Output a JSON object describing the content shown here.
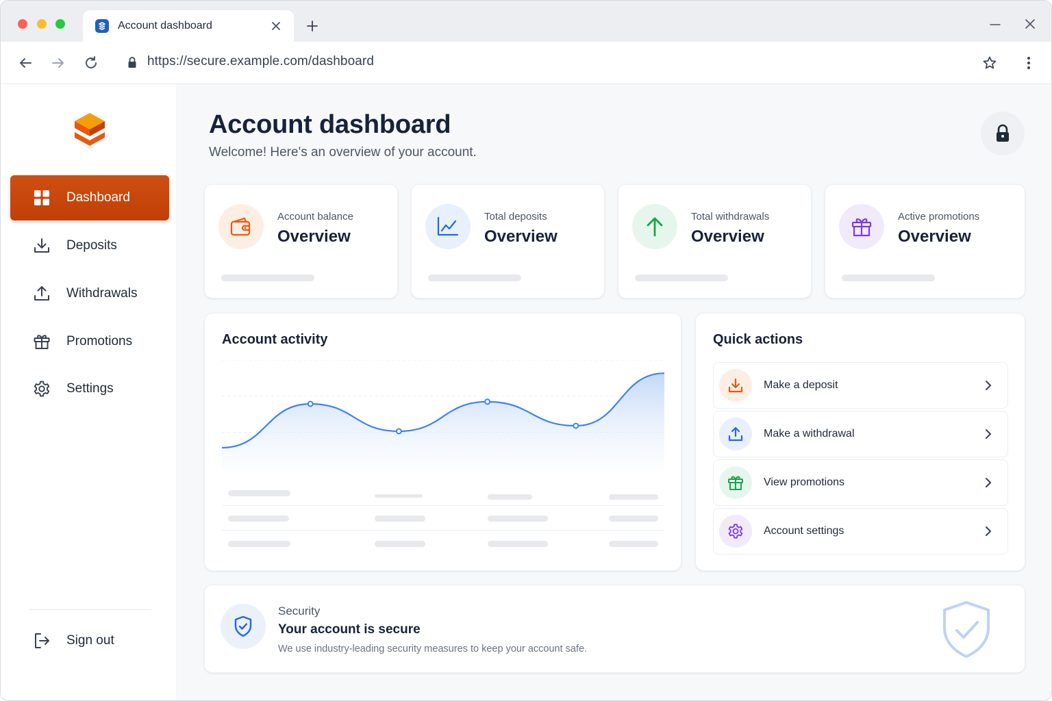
{
  "browser": {
    "tab_title": "Account dashboard",
    "url": "https://secure.example.com/dashboard"
  },
  "sidebar": {
    "items": [
      {
        "label": "Dashboard",
        "icon": "grid-icon",
        "active": true
      },
      {
        "label": "Deposits",
        "icon": "download-icon",
        "active": false
      },
      {
        "label": "Withdrawals",
        "icon": "upload-icon",
        "active": false
      },
      {
        "label": "Promotions",
        "icon": "gift-icon",
        "active": false
      },
      {
        "label": "Settings",
        "icon": "gear-icon",
        "active": false
      }
    ],
    "sign_out": "Sign out"
  },
  "header": {
    "title": "Account dashboard",
    "subtitle": "Welcome! Here's an overview of your account."
  },
  "stats": [
    {
      "label": "Account balance",
      "value": "Overview",
      "icon": "wallet-icon",
      "color": "#ea580c"
    },
    {
      "label": "Total deposits",
      "value": "Overview",
      "icon": "chart-line-icon",
      "color": "#2563eb"
    },
    {
      "label": "Total withdrawals",
      "value": "Overview",
      "icon": "arrow-up-icon",
      "color": "#16a34a"
    },
    {
      "label": "Active promotions",
      "value": "Overview",
      "icon": "gift-icon",
      "color": "#7c3aed"
    }
  ],
  "activity": {
    "title": "Account activity",
    "chart_data": {
      "type": "area",
      "series_color": "#3b82f6",
      "values": [
        0.2,
        0.6,
        0.35,
        0.62,
        0.4,
        0.88
      ],
      "grid": true
    }
  },
  "quick_actions": {
    "title": "Quick actions",
    "items": [
      {
        "label": "Make a deposit",
        "icon": "download-icon",
        "color": "#ea580c"
      },
      {
        "label": "Make a withdrawal",
        "icon": "upload-icon",
        "color": "#2563eb"
      },
      {
        "label": "View promotions",
        "icon": "gift-icon",
        "color": "#16a34a"
      },
      {
        "label": "Account settings",
        "icon": "gear-icon",
        "color": "#7c3aed"
      }
    ]
  },
  "security": {
    "label": "Security",
    "title": "Your account is secure",
    "description": "We use industry-leading security measures to keep your account safe."
  },
  "colors": {
    "accent": "#c2410c",
    "text_dark": "#17223b"
  }
}
